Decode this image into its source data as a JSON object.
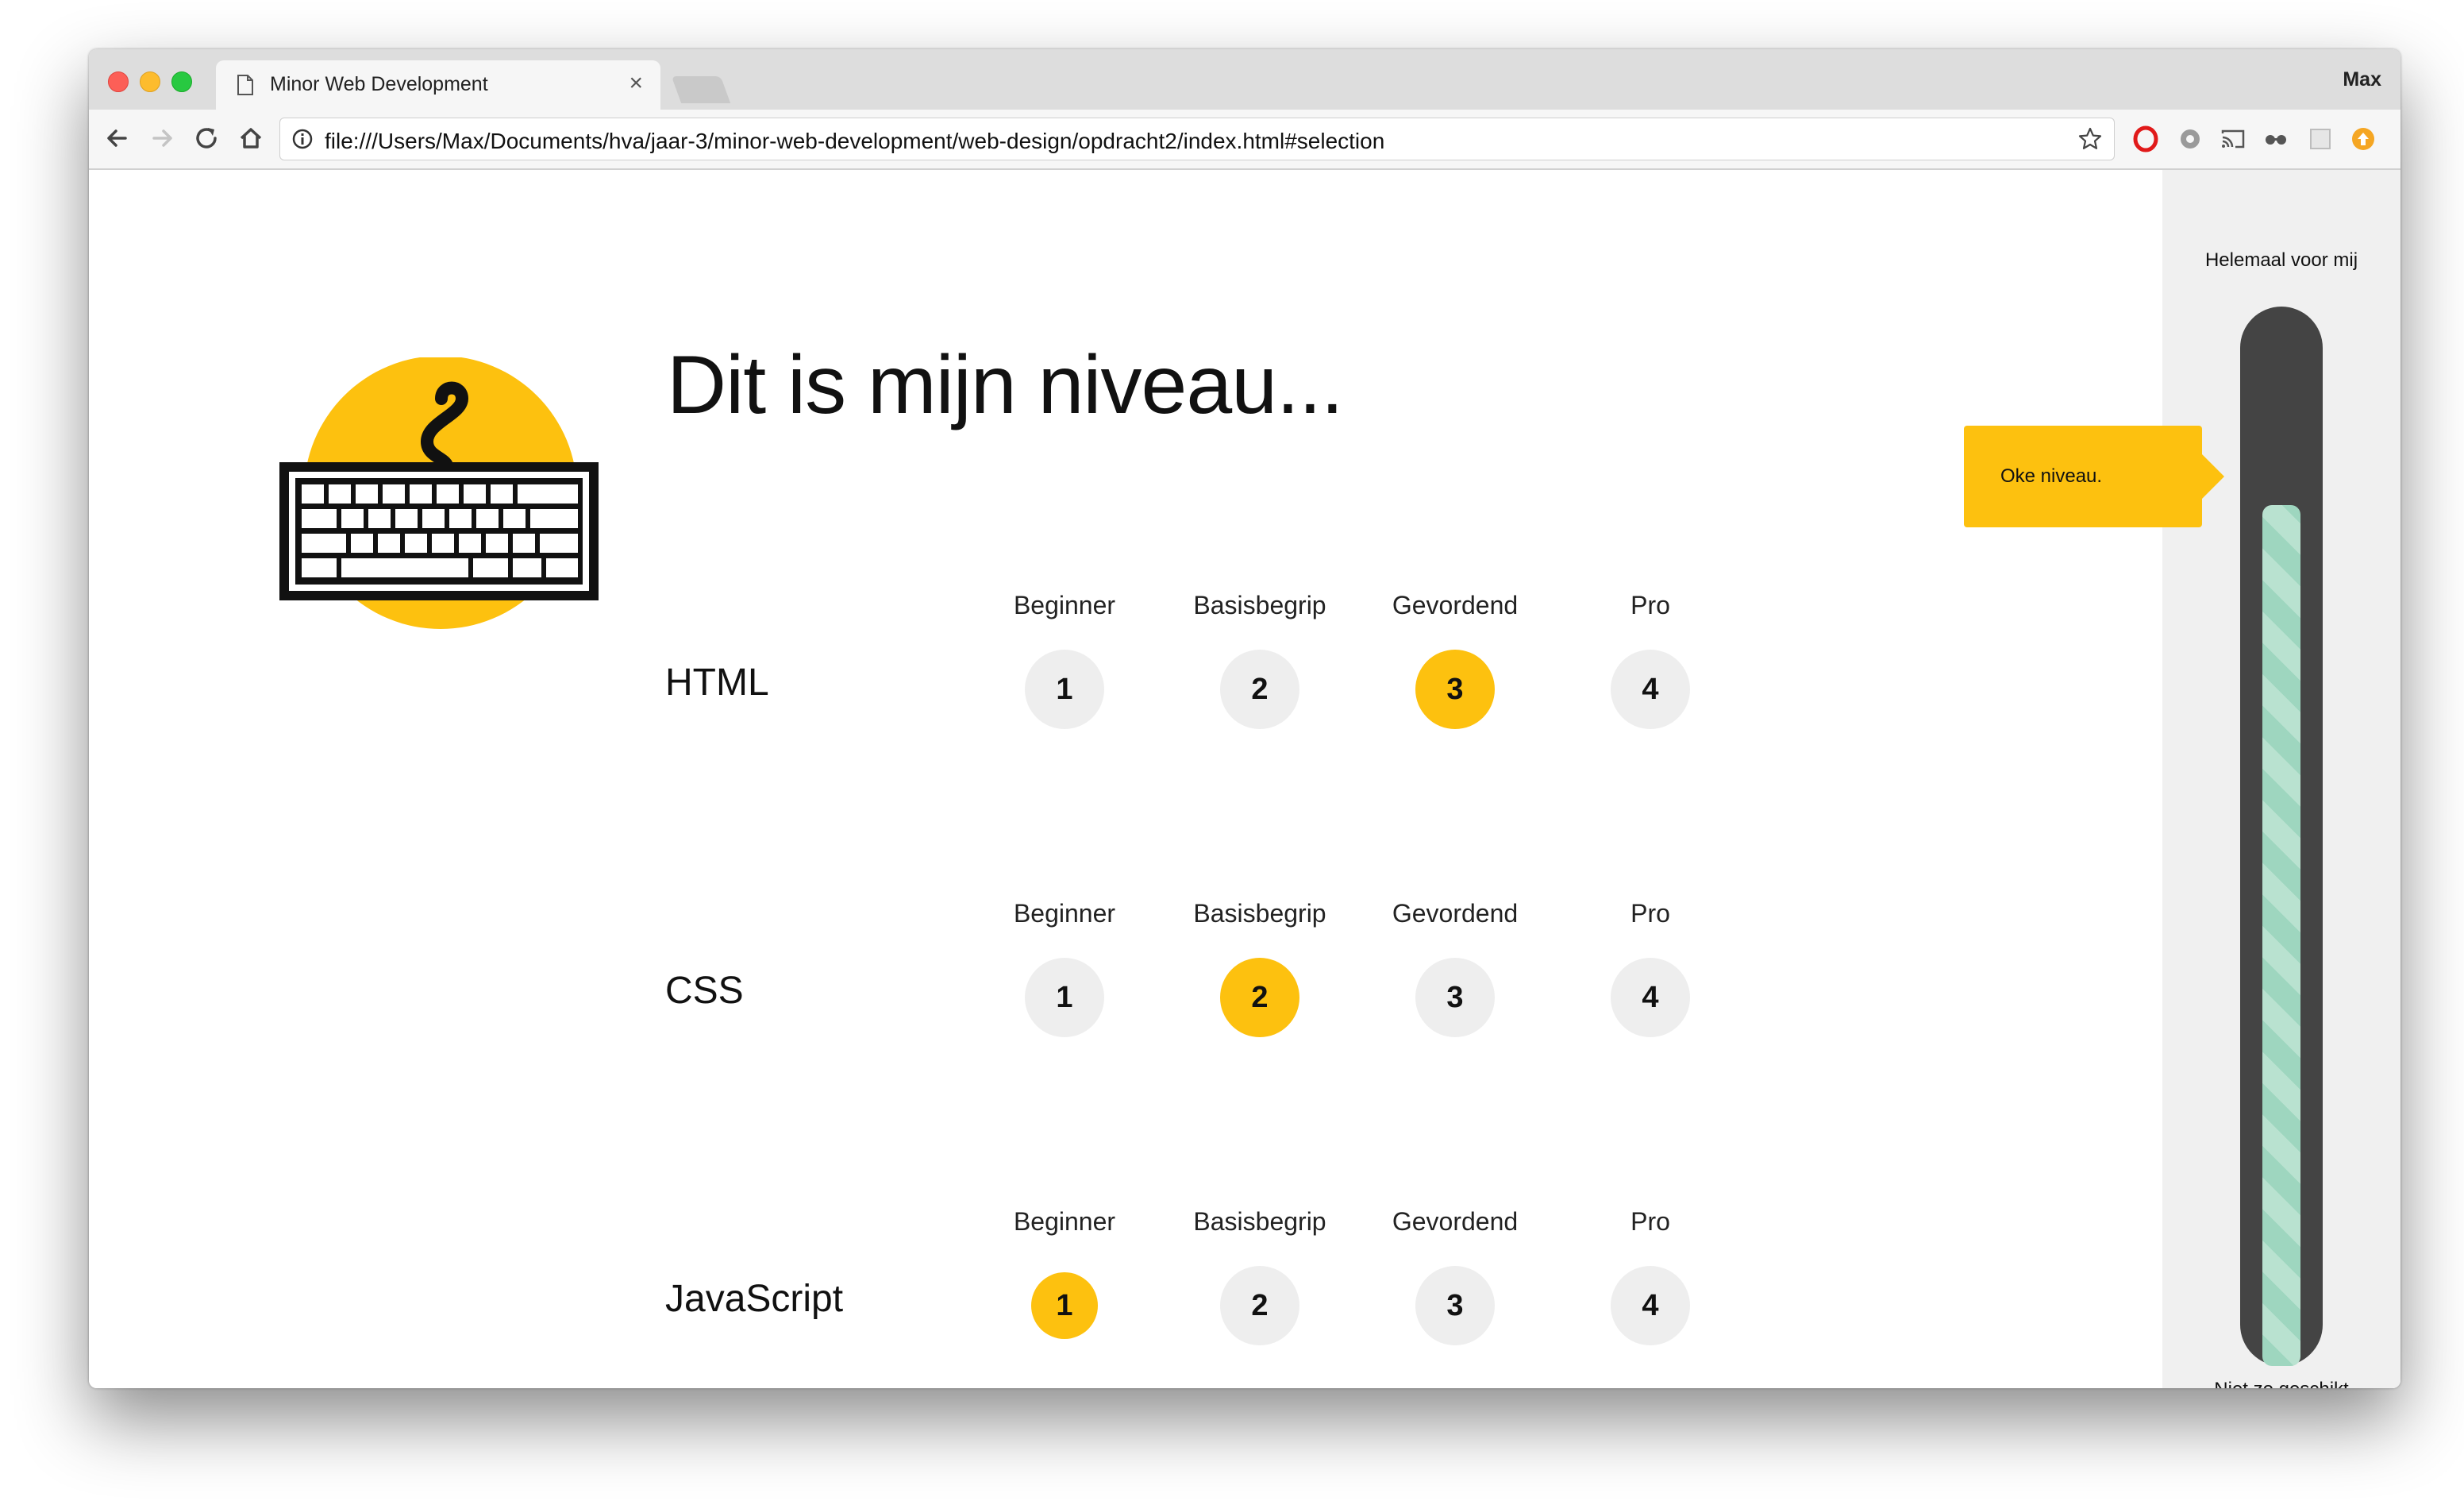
{
  "browser": {
    "tab_title": "Minor Web Development",
    "close_glyph": "×",
    "profile_name": "Max",
    "url": "file:///Users/Max/Documents/hva/jaar-3/minor-web-development/web-design/opdracht2/index.html#selection"
  },
  "page": {
    "heading": "Dit is mijn niveau...",
    "level_labels": [
      "Beginner",
      "Basisbegrip",
      "Gevordend",
      "Pro"
    ],
    "skills": [
      {
        "name": "HTML",
        "levels": [
          "1",
          "2",
          "3",
          "4"
        ],
        "selected": 3
      },
      {
        "name": "CSS",
        "levels": [
          "1",
          "2",
          "3",
          "4"
        ],
        "selected": 2
      },
      {
        "name": "JavaScript",
        "levels": [
          "1",
          "2",
          "3",
          "4"
        ],
        "selected": 1
      }
    ]
  },
  "meter": {
    "top_label": "Helemaal voor mij",
    "bottom_label": "Niet zo geschikt",
    "tooltip": "Oke niveau.",
    "fill_fraction": 0.83
  },
  "colors": {
    "accent": "#fdc10f",
    "button_bg": "#eeeeee",
    "meter_track": "#444444",
    "meter_fill": "#9ed6bf"
  },
  "icons": [
    "document-icon",
    "back-icon",
    "forward-icon",
    "reload-icon",
    "home-icon",
    "info-icon",
    "star-icon",
    "opera-icon",
    "settings-icon",
    "cast-icon",
    "glasses-icon",
    "extension-icon",
    "update-icon",
    "keyboard-logo"
  ]
}
